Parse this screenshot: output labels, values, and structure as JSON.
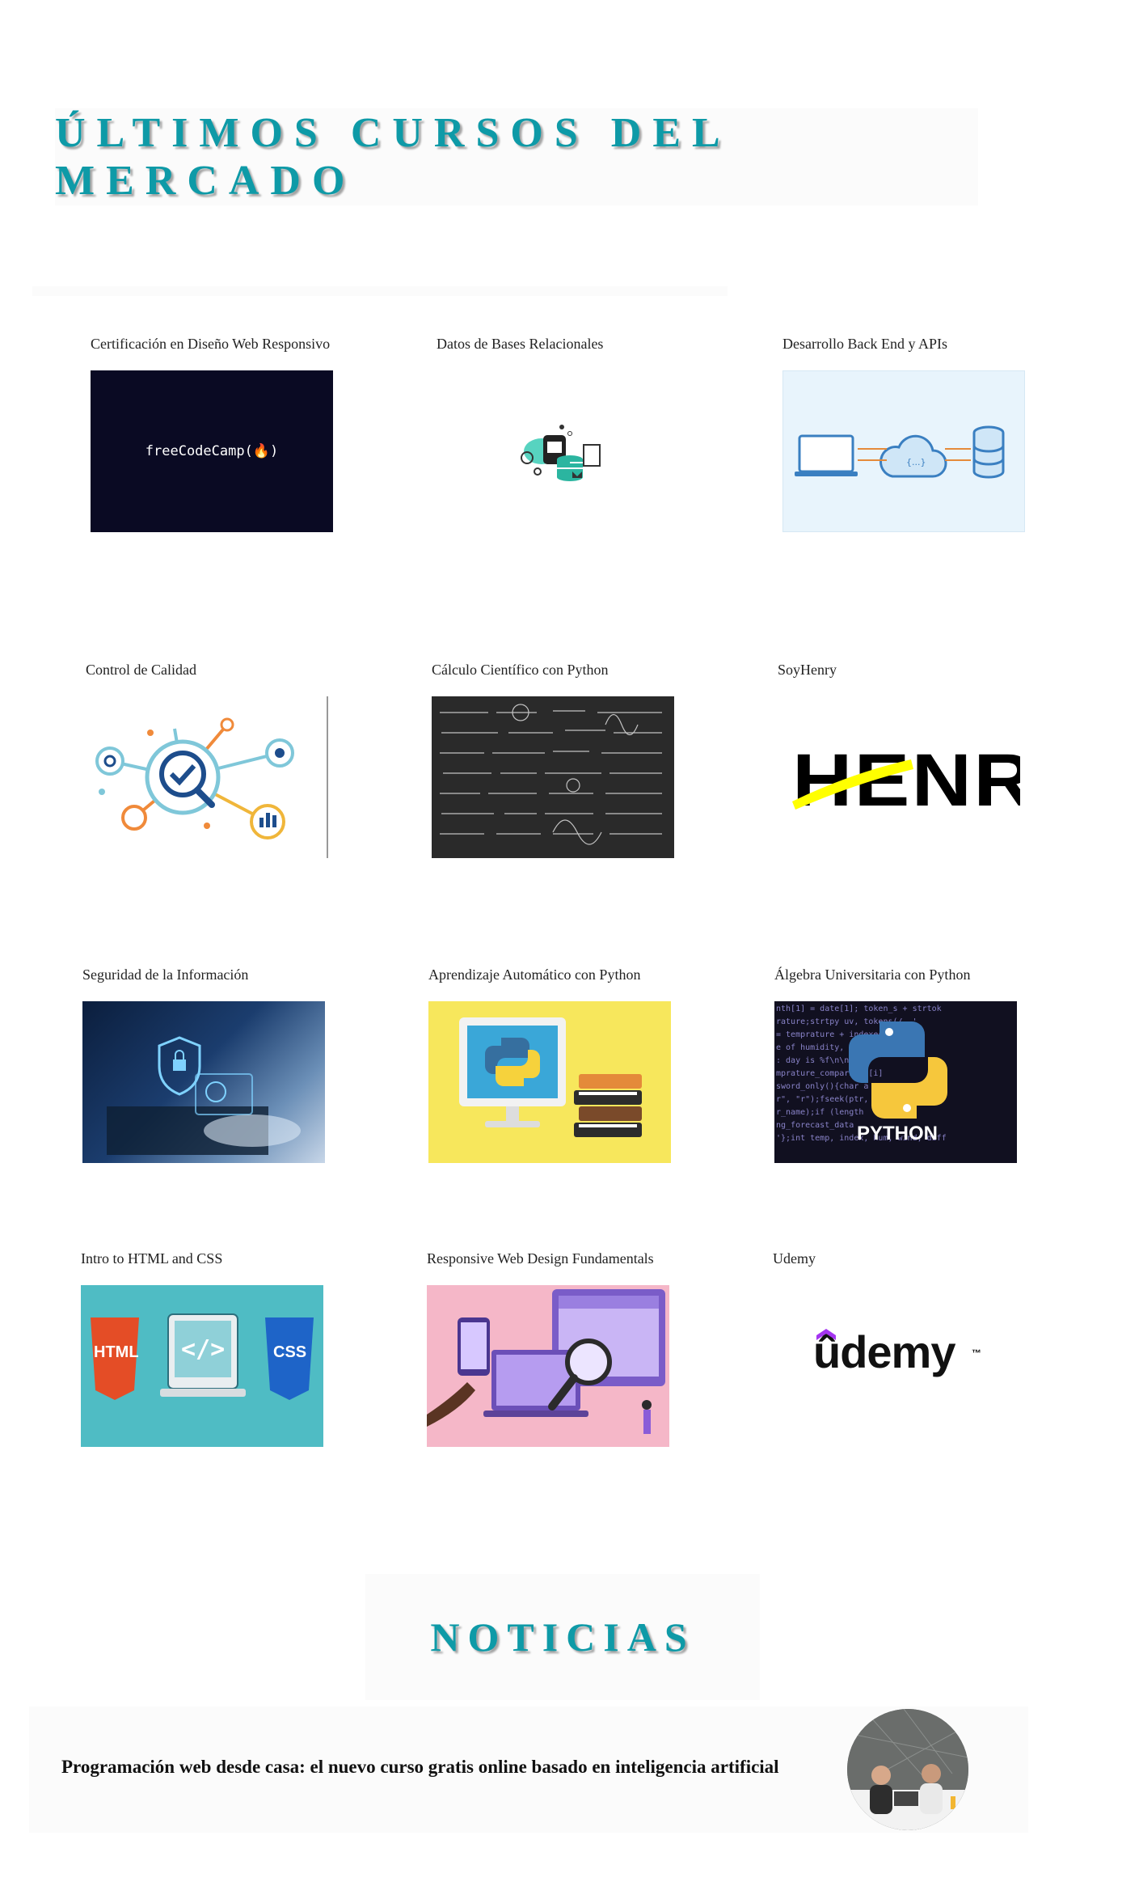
{
  "section_title": "ÚLTIMOS CURSOS DEL MERCADO",
  "courses": [
    {
      "title": "Certificación en Diseño Web Responsivo",
      "thumb_text": "freeCodeCamp(🔥)"
    },
    {
      "title": "Datos de Bases Relacionales",
      "thumb_text": ""
    },
    {
      "title": "Desarrollo Back End y APIs",
      "thumb_text": "{...}"
    },
    {
      "title": "Control de Calidad",
      "thumb_text": ""
    },
    {
      "title": "Cálculo Científico con Python",
      "thumb_text": ""
    },
    {
      "title": "SoyHenry",
      "thumb_text": "HENRY"
    },
    {
      "title": "Seguridad de la Información",
      "thumb_text": ""
    },
    {
      "title": "Aprendizaje Automático con Python",
      "thumb_text": ""
    },
    {
      "title": "Álgebra Universitaria con Python",
      "thumb_text": "PYTHON"
    },
    {
      "title": "Intro to HTML and CSS",
      "thumb_text": ""
    },
    {
      "title": "Responsive Web Design Fundamentals",
      "thumb_text": ""
    },
    {
      "title": "Udemy",
      "thumb_text": "ûdemy"
    }
  ],
  "html_css_thumb": {
    "html_label": "HTML",
    "code_label": "</>",
    "css_label": "CSS"
  },
  "news": {
    "title": "NOTICIAS",
    "headline": "Programación web desde casa: el nuevo curso gratis online basado en inteligencia artificial"
  },
  "colors": {
    "accent": "#0e9aa7",
    "fcc_bg": "#0a0a23",
    "henry_yellow": "#ffff00"
  }
}
